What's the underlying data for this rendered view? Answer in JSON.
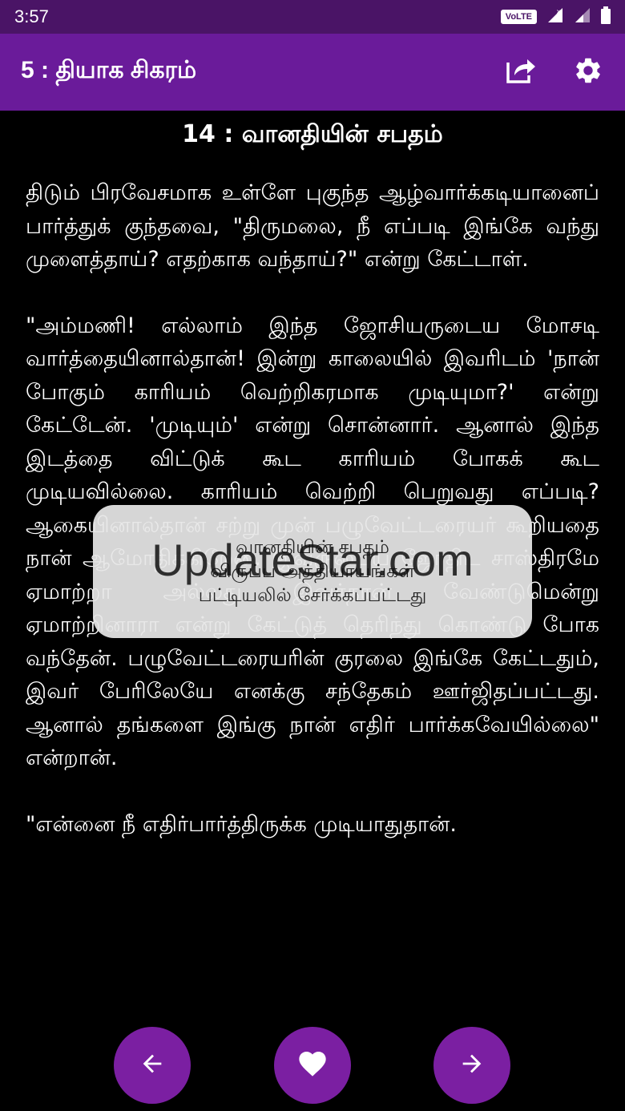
{
  "status_bar": {
    "time": "3:57",
    "volte": "VoLTE"
  },
  "app_bar": {
    "title": "5 : தியாக சிகரம்",
    "icons": [
      "share-icon",
      "settings-icon"
    ]
  },
  "chapter": {
    "title": "14 : வானதியின் சபதம்"
  },
  "content": {
    "paragraphs": [
      "திடும் பிரவேசமாக உள்ளே புகுந்த ஆழ்வார்க்கடியானைப் பார்த்துக் குந்தவை, \"திருமலை, நீ எப்படி இங்கே வந்து முளைத்தாய்? எதற்காக வந்தாய்?\" என்று கேட்டாள்.",
      "\"அம்மணி! எல்லாம் இந்த ஜோசியருடைய மோசடி வார்த்தையினால்தான்! இன்று காலையில் இவரிடம் 'நான் போகும் காரியம் வெற்றிகரமாக முடியுமா?' என்று கேட்டேன். 'முடியும்' என்று சொன்னார். ஆனால் இந்த இடத்தை விட்டுக் கூட காரியம் போகக் கூட முடியவில்லை. காரியம் வெற்றி பெறுவது எப்படி? ஆகையினால்தான் சற்று முன் பழுவேட்டரையர் கூறியதை நான் ஆமோதிக்கிறேன். இவருடைய ஜோதிட சாஸ்திரமே ஏமாற்றா அல்லது இவர்தான் வேண்டுமென்று ஏமாற்றினாரா என்று கேட்டுத் தெரிந்து கொண்டு போக வந்தேன். பழுவேட்டரையரின் குரலை இங்கே கேட்டதும், இவர் பேரிலேயே எனக்கு சந்தேகம் ஊர்ஜிதப்பட்டது. ஆனால் தங்களை இங்கு நான் எதிர் பார்க்கவேயில்லை\" என்றான்.",
      "\"என்னை நீ எதிர்பார்த்திருக்க முடியாதுதான்."
    ]
  },
  "toast": {
    "line1": "வானதியின் சபதம்",
    "line2": "விருப்ப அத்தியாயங்கள்",
    "line3": "பட்டியலில் சேர்க்கப்பட்டது",
    "watermark": "UpdateStar.com"
  },
  "nav": {
    "prev": "arrow-left-icon",
    "favorite": "heart-icon",
    "next": "arrow-right-icon"
  },
  "colors": {
    "status_bar": "#4a1466",
    "app_bar": "#6a1b9a",
    "fab": "#7b1fa2",
    "background": "#000000"
  }
}
